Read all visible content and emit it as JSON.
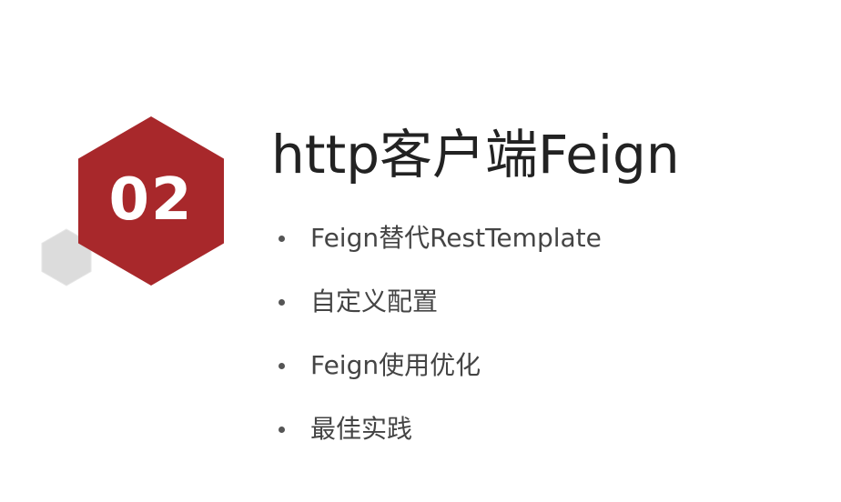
{
  "section": {
    "number": "02",
    "title": "http客户端Feign"
  },
  "bullets": [
    {
      "text": "Feign替代RestTemplate"
    },
    {
      "text": "自定义配置"
    },
    {
      "text": "Feign使用优化"
    },
    {
      "text": "最佳实践"
    }
  ],
  "colors": {
    "accent_hexagon": "#A8282B",
    "secondary_hexagon": "#DDDDDD",
    "title_text": "#222222",
    "bullet_text": "#444444"
  }
}
